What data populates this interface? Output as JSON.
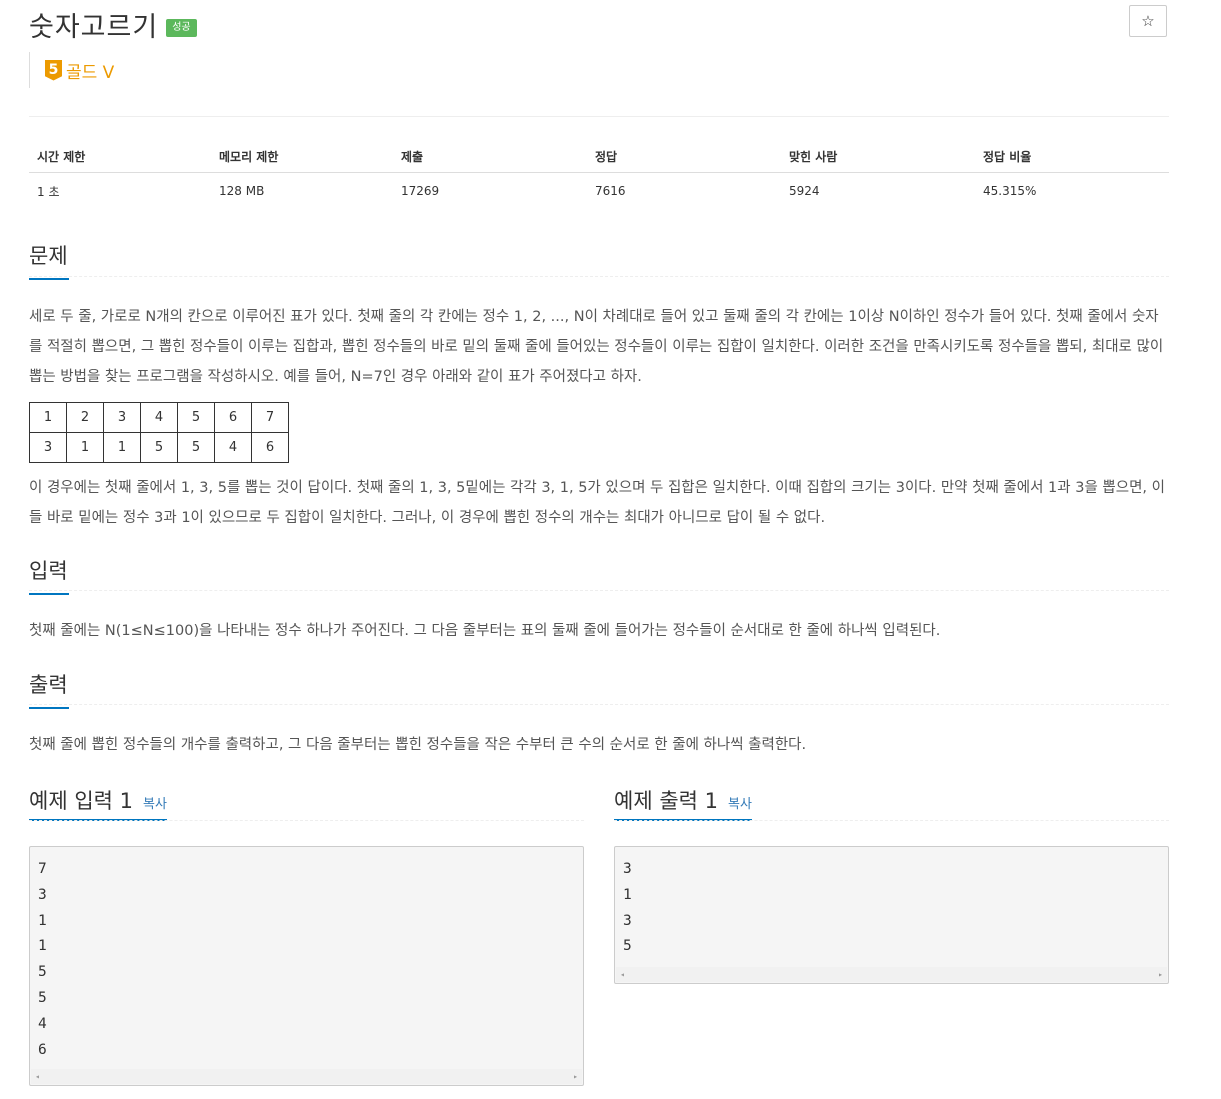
{
  "header": {
    "title": "숫자고르기",
    "badge": "성공",
    "star": "☆",
    "tier_level": "5",
    "tier_name": "골드 V"
  },
  "stats": {
    "headers": [
      "시간 제한",
      "메모리 제한",
      "제출",
      "정답",
      "맞힌 사람",
      "정답 비율"
    ],
    "values": [
      "1 초",
      "128 MB",
      "17269",
      "7616",
      "5924",
      "45.315%"
    ]
  },
  "problem": {
    "title": "문제",
    "text1": "세로 두 줄, 가로로 N개의 칸으로 이루어진 표가 있다. 첫째 줄의 각 칸에는 정수 1, 2, ..., N이 차례대로 들어 있고 둘째 줄의 각 칸에는 1이상 N이하인 정수가 들어 있다. 첫째 줄에서 숫자를 적절히 뽑으면, 그 뽑힌 정수들이 이루는 집합과, 뽑힌 정수들의 바로 밑의 둘째 줄에 들어있는 정수들이 이루는 집합이 일치한다. 이러한 조건을 만족시키도록 정수들을 뽑되, 최대로 많이 뽑는 방법을 찾는 프로그램을 작성하시오. 예를 들어, N=7인 경우 아래와 같이 표가 주어졌다고 하자.",
    "table_row1": [
      "1",
      "2",
      "3",
      "4",
      "5",
      "6",
      "7"
    ],
    "table_row2": [
      "3",
      "1",
      "1",
      "5",
      "5",
      "4",
      "6"
    ],
    "text2": "이 경우에는 첫째 줄에서 1, 3, 5를 뽑는 것이 답이다. 첫째 줄의 1, 3, 5밑에는 각각 3, 1, 5가 있으며 두 집합은 일치한다. 이때 집합의 크기는 3이다. 만약 첫째 줄에서 1과 3을 뽑으면, 이들 바로 밑에는 정수 3과 1이 있으므로 두 집합이 일치한다. 그러나, 이 경우에 뽑힌 정수의 개수는 최대가 아니므로 답이 될 수 없다."
  },
  "input": {
    "title": "입력",
    "text": "첫째 줄에는 N(1≤N≤100)을 나타내는 정수 하나가 주어진다. 그 다음 줄부터는 표의 둘째 줄에 들어가는 정수들이 순서대로 한 줄에 하나씩 입력된다."
  },
  "output": {
    "title": "출력",
    "text": "첫째 줄에 뽑힌 정수들의 개수를 출력하고, 그 다음 줄부터는 뽑힌 정수들을 작은 수부터 큰 수의 순서로 한 줄에 하나씩 출력한다."
  },
  "sample_input": {
    "title": "예제 입력 1",
    "copy": "복사",
    "lines": [
      "7",
      "3",
      "1",
      "1",
      "5",
      "5",
      "4",
      "6"
    ]
  },
  "sample_output": {
    "title": "예제 출력 1",
    "copy": "복사",
    "lines": [
      "3",
      "1",
      "3",
      "5"
    ]
  },
  "scroll": {
    "left": "◂",
    "right": "▸"
  }
}
